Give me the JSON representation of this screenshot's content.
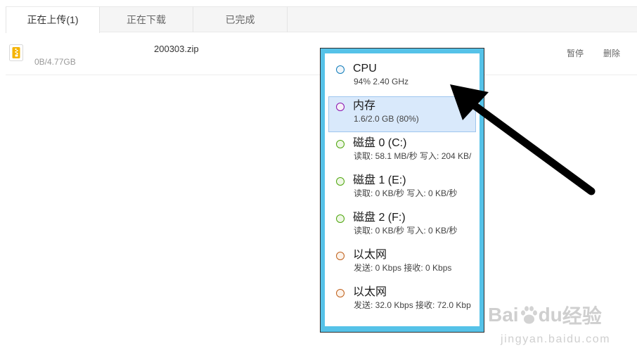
{
  "tabs": [
    {
      "label": "正在上传(1)",
      "active": true
    },
    {
      "label": "正在下载",
      "active": false
    },
    {
      "label": "已完成",
      "active": false
    }
  ],
  "upload_item": {
    "icon": "zip-file-icon",
    "name": "200303.zip",
    "size": "0B/4.77GB",
    "actions": {
      "pause": "暂停",
      "delete": "删除"
    }
  },
  "perf_panel": {
    "items": [
      {
        "title": "CPU",
        "detail": "94% 2.40 GHz",
        "color": "#117dbb",
        "fill": "#f1f6fa",
        "selected": false
      },
      {
        "title": "内存",
        "detail": "1.6/2.0 GB (80%)",
        "color": "#8b12ae",
        "fill": "#f6f0f8",
        "selected": true
      },
      {
        "title": "磁盘 0 (C:)",
        "detail": "读取: 58.1 MB/秒 写入: 204 KB/",
        "color": "#4da60c",
        "fill": "#eff7e6",
        "selected": false
      },
      {
        "title": "磁盘 1 (E:)",
        "detail": "读取: 0 KB/秒 写入: 0 KB/秒",
        "color": "#4da60c",
        "fill": "#eff7e6",
        "selected": false
      },
      {
        "title": "磁盘 2 (F:)",
        "detail": "读取: 0 KB/秒 写入: 0 KB/秒",
        "color": "#4da60c",
        "fill": "#eff7e6",
        "selected": false
      },
      {
        "title": "以太网",
        "detail": "发送: 0 Kbps 接收: 0 Kbps",
        "color": "#c0601a",
        "fill": "#fcf3eb",
        "selected": false
      },
      {
        "title": "以太网",
        "detail": "发送: 32.0 Kbps 接收: 72.0 Kbp",
        "color": "#c0601a",
        "fill": "#fcf3eb",
        "selected": false
      }
    ]
  },
  "colors": {
    "panel_frame": "#55c2e8",
    "annotation_arrow": "#000000"
  },
  "watermark": {
    "bai": "Bai",
    "du": "du",
    "jingyan": "经验",
    "url": "jingyan.baidu.com",
    "icon": "paw-icon"
  }
}
